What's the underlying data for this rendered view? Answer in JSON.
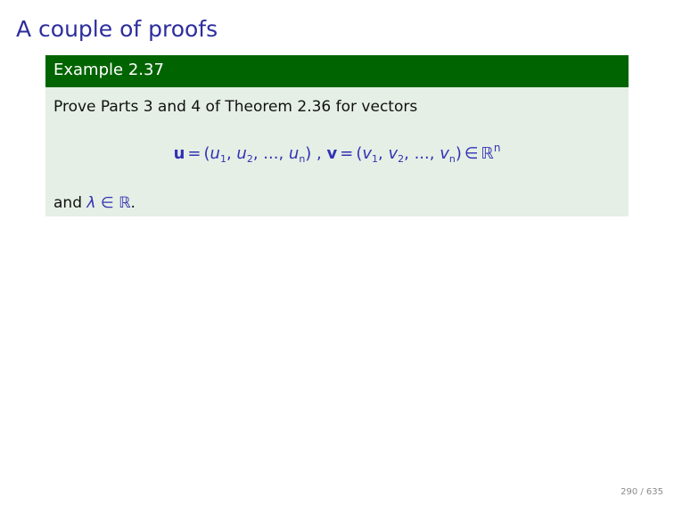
{
  "slide": {
    "title": "A couple of proofs",
    "block": {
      "header": "Example 2.37",
      "intro": "Prove Parts 3 and 4 of Theorem 2.36 for vectors",
      "equation": {
        "u_vec": "u",
        "v_vec": "v",
        "u_components": [
          "u",
          "u",
          "u"
        ],
        "u_subscripts": [
          "1",
          "2",
          "n"
        ],
        "v_components": [
          "v",
          "v",
          "v"
        ],
        "v_subscripts": [
          "1",
          "2",
          "n"
        ],
        "ellipsis": "...",
        "equals": "=",
        "element_of": "∈",
        "space": "ℝ",
        "space_exponent": "n"
      },
      "closing": {
        "prefix": "and",
        "variable": "λ",
        "element_of": "∈",
        "space": "ℝ",
        "suffix": "."
      }
    },
    "page_counter": "290 / 635"
  }
}
